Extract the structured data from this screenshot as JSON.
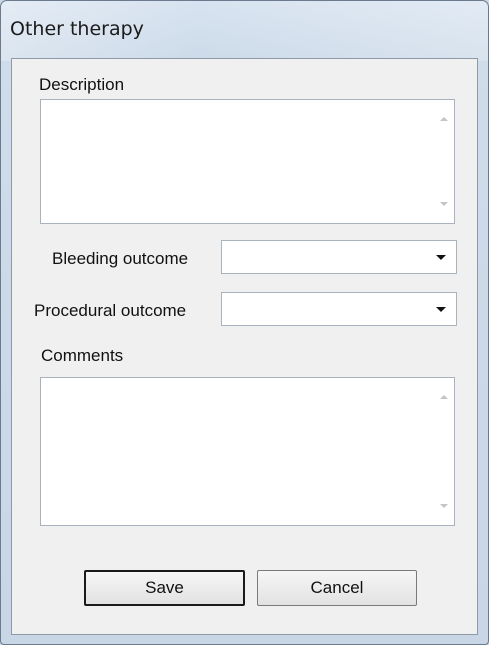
{
  "window": {
    "title": "Other therapy"
  },
  "form": {
    "description_label": "Description",
    "description_value": "",
    "bleeding_label": "Bleeding outcome",
    "bleeding_value": "",
    "procedural_label": "Procedural outcome",
    "procedural_value": "",
    "comments_label": "Comments",
    "comments_value": ""
  },
  "buttons": {
    "save": "Save",
    "cancel": "Cancel"
  },
  "icons": {
    "dropdown": "chevron-down-icon",
    "scroll_up": "scroll-up-arrow-icon",
    "scroll_down": "scroll-down-arrow-icon"
  }
}
